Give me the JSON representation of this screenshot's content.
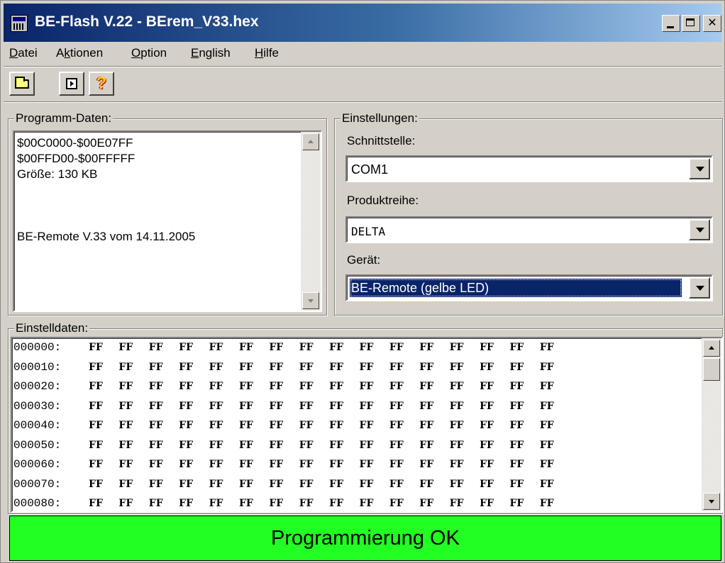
{
  "window": {
    "title": "BE-Flash V.22 - BErem_V33.hex"
  },
  "menu": [
    {
      "accel": "D",
      "rest": "atei"
    },
    {
      "pre": "A",
      "accel": "k",
      "rest": "tionen"
    },
    {
      "accel": "O",
      "rest": "ption"
    },
    {
      "accel": "E",
      "rest": "nglish"
    },
    {
      "accel": "H",
      "rest": "ilfe"
    }
  ],
  "toolbar": {
    "open_icon": "folder-open-icon",
    "run_icon": "run-icon",
    "help_icon": "help-icon",
    "help_glyph": "?"
  },
  "programm_daten": {
    "label": "Programm-Daten:",
    "lines": [
      "$00C0000-$00E07FF",
      "$00FFD00-$00FFFFF",
      "Größe: 130 KB",
      "",
      "",
      "BE-Remote V.33 vom 14.11.2005"
    ]
  },
  "einstellungen": {
    "label": "Einstellungen:",
    "schnittstelle_label": "Schnittstelle:",
    "schnittstelle_value": "COM1",
    "produktreihe_label": "Produktreihe:",
    "produktreihe_value": "DELTA",
    "geraet_label": "Gerät:",
    "geraet_value": "BE-Remote (gelbe LED)"
  },
  "einstelldaten": {
    "label": "Einstelldaten:",
    "rows": [
      {
        "addr": "000000:",
        "bytes": [
          "FF",
          "FF",
          "FF",
          "FF",
          "FF",
          "FF",
          "FF",
          "FF",
          "FF",
          "FF",
          "FF",
          "FF",
          "FF",
          "FF",
          "FF",
          "FF"
        ]
      },
      {
        "addr": "000010:",
        "bytes": [
          "FF",
          "FF",
          "FF",
          "FF",
          "FF",
          "FF",
          "FF",
          "FF",
          "FF",
          "FF",
          "FF",
          "FF",
          "FF",
          "FF",
          "FF",
          "FF"
        ]
      },
      {
        "addr": "000020:",
        "bytes": [
          "FF",
          "FF",
          "FF",
          "FF",
          "FF",
          "FF",
          "FF",
          "FF",
          "FF",
          "FF",
          "FF",
          "FF",
          "FF",
          "FF",
          "FF",
          "FF"
        ]
      },
      {
        "addr": "000030:",
        "bytes": [
          "FF",
          "FF",
          "FF",
          "FF",
          "FF",
          "FF",
          "FF",
          "FF",
          "FF",
          "FF",
          "FF",
          "FF",
          "FF",
          "FF",
          "FF",
          "FF"
        ]
      },
      {
        "addr": "000040:",
        "bytes": [
          "FF",
          "FF",
          "FF",
          "FF",
          "FF",
          "FF",
          "FF",
          "FF",
          "FF",
          "FF",
          "FF",
          "FF",
          "FF",
          "FF",
          "FF",
          "FF"
        ]
      },
      {
        "addr": "000050:",
        "bytes": [
          "FF",
          "FF",
          "FF",
          "FF",
          "FF",
          "FF",
          "FF",
          "FF",
          "FF",
          "FF",
          "FF",
          "FF",
          "FF",
          "FF",
          "FF",
          "FF"
        ]
      },
      {
        "addr": "000060:",
        "bytes": [
          "FF",
          "FF",
          "FF",
          "FF",
          "FF",
          "FF",
          "FF",
          "FF",
          "FF",
          "FF",
          "FF",
          "FF",
          "FF",
          "FF",
          "FF",
          "FF"
        ]
      },
      {
        "addr": "000070:",
        "bytes": [
          "FF",
          "FF",
          "FF",
          "FF",
          "FF",
          "FF",
          "FF",
          "FF",
          "FF",
          "FF",
          "FF",
          "FF",
          "FF",
          "FF",
          "FF",
          "FF"
        ]
      },
      {
        "addr": "000080:",
        "bytes": [
          "FF",
          "FF",
          "FF",
          "FF",
          "FF",
          "FF",
          "FF",
          "FF",
          "FF",
          "FF",
          "FF",
          "FF",
          "FF",
          "FF",
          "FF",
          "FF"
        ]
      }
    ]
  },
  "status": {
    "text": "Programmierung OK",
    "color": "#22ff22"
  }
}
